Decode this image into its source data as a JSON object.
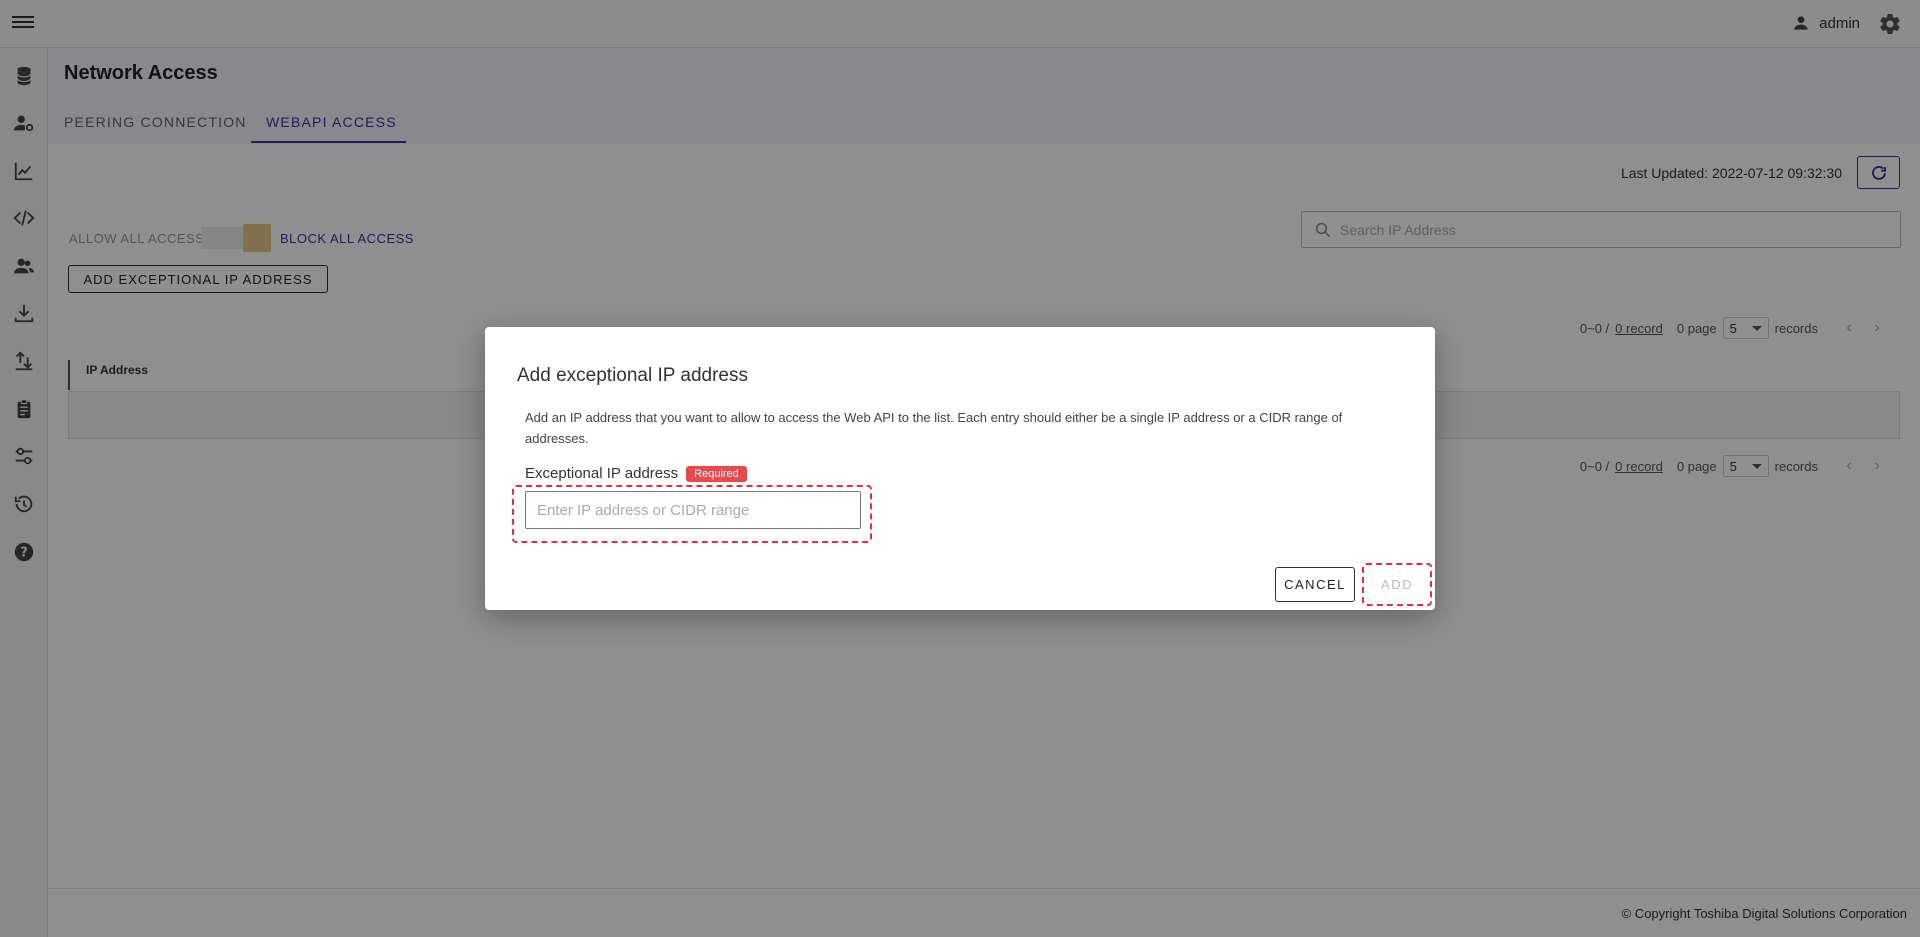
{
  "topbar": {
    "menu_icon": "hamburger-icon",
    "user_icon": "person-icon",
    "username": "admin",
    "settings_icon": "gear-icon"
  },
  "sidebar": {
    "items": [
      {
        "icon": "database-icon"
      },
      {
        "icon": "user-settings-icon"
      },
      {
        "icon": "chart-line-icon"
      },
      {
        "icon": "code-icon"
      },
      {
        "icon": "users-icon"
      },
      {
        "icon": "download-icon"
      },
      {
        "icon": "upload-transfer-icon"
      },
      {
        "icon": "clipboard-icon"
      },
      {
        "icon": "sliders-icon"
      },
      {
        "icon": "history-icon"
      },
      {
        "icon": "help-icon"
      }
    ]
  },
  "page": {
    "title": "Network Access",
    "tabs": [
      {
        "label": "PEERING CONNECTION",
        "active": false
      },
      {
        "label": "WEBAPI ACCESS",
        "active": true
      }
    ]
  },
  "toolbar": {
    "last_updated": "Last Updated: 2022-07-12 09:32:30",
    "refresh_icon": "refresh-icon",
    "allow_all_label": "ALLOW ALL ACCESS",
    "block_all_label": "BLOCK ALL ACCESS",
    "add_exceptional_label": "ADD EXCEPTIONAL IP ADDRESS",
    "search_placeholder": "Search IP Address"
  },
  "pager": {
    "range": "0~0 /",
    "records_link": "0 record",
    "page_text": "0 page",
    "page_size": "5",
    "records_label": "records",
    "prev": "‹",
    "next": "›"
  },
  "table": {
    "columns": [
      "IP Address"
    ],
    "rows": []
  },
  "footer": {
    "copyright": "© Copyright Toshiba Digital Solutions Corporation"
  },
  "dialog": {
    "title": "Add exceptional IP address",
    "description": "Add an IP address that you want to allow to access the Web API to the list. Each entry should either be a single IP address or a CIDR range of addresses.",
    "field_label": "Exceptional IP address",
    "required_badge": "Required",
    "input_placeholder": "Enter IP address or CIDR range",
    "input_value": "",
    "cancel_label": "CANCEL",
    "add_label": "ADD"
  },
  "colors": {
    "accent": "#3b33a8",
    "required": "#e64a4a",
    "highlight": "#e0323c",
    "toggle_knob": "#e7c98b"
  }
}
